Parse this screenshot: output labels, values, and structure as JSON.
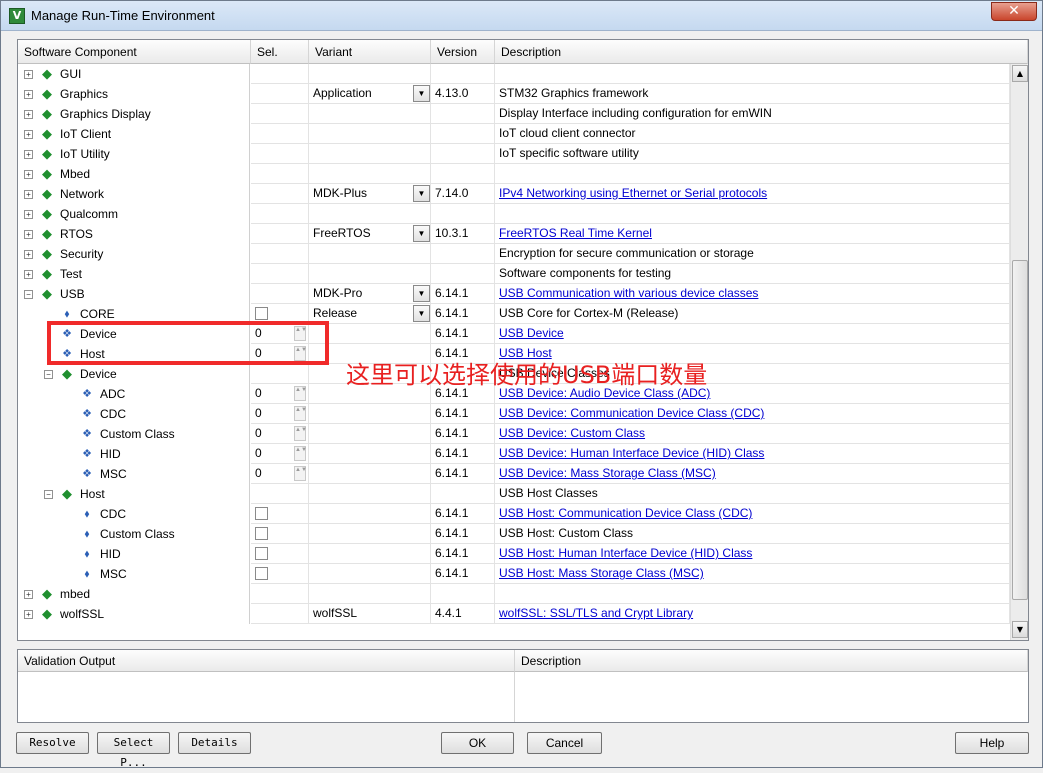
{
  "window": {
    "title": "Manage Run-Time Environment",
    "close_glyph": "✕"
  },
  "columns": {
    "component": "Software Component",
    "sel": "Sel.",
    "variant": "Variant",
    "version": "Version",
    "description": "Description"
  },
  "rows": [
    {
      "label": "GUI",
      "level": 0,
      "icon": "green-diamond-icon",
      "expander": "+",
      "sel": "",
      "variant": "",
      "version": "",
      "description": "",
      "link": false
    },
    {
      "label": "Graphics",
      "level": 0,
      "icon": "green-diamond-icon",
      "expander": "+",
      "sel": "",
      "variant": "Application",
      "variant_dropdown": true,
      "version": "4.13.0",
      "description": "STM32 Graphics framework",
      "link": false
    },
    {
      "label": "Graphics Display",
      "level": 0,
      "icon": "green-diamond-icon",
      "expander": "+",
      "sel": "",
      "variant": "",
      "version": "",
      "description": "Display Interface including configuration for emWIN",
      "link": false
    },
    {
      "label": "IoT Client",
      "level": 0,
      "icon": "green-diamond-icon",
      "expander": "+",
      "sel": "",
      "variant": "",
      "version": "",
      "description": "IoT cloud client connector",
      "link": false
    },
    {
      "label": "IoT Utility",
      "level": 0,
      "icon": "green-diamond-icon",
      "expander": "+",
      "sel": "",
      "variant": "",
      "version": "",
      "description": "IoT specific software utility",
      "link": false
    },
    {
      "label": "Mbed",
      "level": 0,
      "icon": "green-diamond-icon",
      "expander": "+",
      "sel": "",
      "variant": "",
      "version": "",
      "description": "",
      "link": false
    },
    {
      "label": "Network",
      "level": 0,
      "icon": "green-diamond-icon",
      "expander": "+",
      "sel": "",
      "variant": "MDK-Plus",
      "variant_dropdown": true,
      "version": "7.14.0",
      "description": "IPv4 Networking using Ethernet or Serial protocols",
      "link": true
    },
    {
      "label": "Qualcomm",
      "level": 0,
      "icon": "green-diamond-icon",
      "expander": "+",
      "sel": "",
      "variant": "",
      "version": "",
      "description": "",
      "link": false
    },
    {
      "label": "RTOS",
      "level": 0,
      "icon": "green-diamond-icon",
      "expander": "+",
      "sel": "",
      "variant": "FreeRTOS",
      "variant_dropdown": true,
      "version": "10.3.1",
      "description": "FreeRTOS Real Time Kernel",
      "link": true
    },
    {
      "label": "Security",
      "level": 0,
      "icon": "green-diamond-icon",
      "expander": "+",
      "sel": "",
      "variant": "",
      "version": "",
      "description": "Encryption for secure communication or storage",
      "link": false
    },
    {
      "label": "Test",
      "level": 0,
      "icon": "green-diamond-icon",
      "expander": "+",
      "sel": "",
      "variant": "",
      "version": "",
      "description": "Software components for testing",
      "link": false
    },
    {
      "label": "USB",
      "level": 0,
      "icon": "green-diamond-icon",
      "expander": "−",
      "sel": "",
      "variant": "MDK-Pro",
      "variant_dropdown": true,
      "version": "6.14.1",
      "description": "USB Communication with various device classes",
      "link": true
    },
    {
      "label": "CORE",
      "level": 1,
      "icon": "blue-component-icon",
      "expander": "",
      "sel": "checkbox",
      "variant": "Release",
      "variant_dropdown": true,
      "version": "6.14.1",
      "description": "USB Core for Cortex-M (Release)",
      "link": false
    },
    {
      "label": "Device",
      "level": 1,
      "icon": "blue-multi-icon",
      "expander": "",
      "sel": "0",
      "sel_spin": true,
      "variant": "",
      "version": "6.14.1",
      "description": "USB Device",
      "link": true
    },
    {
      "label": "Host",
      "level": 1,
      "icon": "blue-multi-icon",
      "expander": "",
      "sel": "0",
      "sel_spin": true,
      "variant": "",
      "version": "6.14.1",
      "description": "USB Host",
      "link": true
    },
    {
      "label": "Device",
      "level": 1,
      "icon": "green-diamond-icon",
      "expander": "−",
      "sel": "",
      "variant": "",
      "version": "",
      "description": "USB Device Classes",
      "link": false
    },
    {
      "label": "ADC",
      "level": 2,
      "icon": "blue-multi-icon",
      "expander": "",
      "sel": "0",
      "sel_spin": true,
      "variant": "",
      "version": "6.14.1",
      "description": "USB Device: Audio Device Class (ADC)",
      "link": true
    },
    {
      "label": "CDC",
      "level": 2,
      "icon": "blue-multi-icon",
      "expander": "",
      "sel": "0",
      "sel_spin": true,
      "variant": "",
      "version": "6.14.1",
      "description": "USB Device: Communication Device Class (CDC)",
      "link": true
    },
    {
      "label": "Custom Class",
      "level": 2,
      "icon": "blue-multi-icon",
      "expander": "",
      "sel": "0",
      "sel_spin": true,
      "variant": "",
      "version": "6.14.1",
      "description": "USB Device: Custom Class",
      "link": true
    },
    {
      "label": "HID",
      "level": 2,
      "icon": "blue-multi-icon",
      "expander": "",
      "sel": "0",
      "sel_spin": true,
      "variant": "",
      "version": "6.14.1",
      "description": "USB Device: Human Interface Device (HID) Class",
      "link": true
    },
    {
      "label": "MSC",
      "level": 2,
      "icon": "blue-multi-icon",
      "expander": "",
      "sel": "0",
      "sel_spin": true,
      "variant": "",
      "version": "6.14.1",
      "description": "USB Device: Mass Storage Class (MSC)",
      "link": true
    },
    {
      "label": "Host",
      "level": 1,
      "icon": "green-diamond-icon",
      "expander": "−",
      "sel": "",
      "variant": "",
      "version": "",
      "description": "USB Host Classes",
      "link": false
    },
    {
      "label": "CDC",
      "level": 2,
      "icon": "blue-component-icon",
      "expander": "",
      "sel": "checkbox",
      "variant": "",
      "version": "6.14.1",
      "description": "USB Host: Communication Device Class (CDC)",
      "link": true
    },
    {
      "label": "Custom Class",
      "level": 2,
      "icon": "blue-component-icon",
      "expander": "",
      "sel": "checkbox",
      "variant": "",
      "version": "6.14.1",
      "description": "USB Host: Custom Class",
      "link": false
    },
    {
      "label": "HID",
      "level": 2,
      "icon": "blue-component-icon",
      "expander": "",
      "sel": "checkbox",
      "variant": "",
      "version": "6.14.1",
      "description": "USB Host: Human Interface Device (HID) Class",
      "link": true
    },
    {
      "label": "MSC",
      "level": 2,
      "icon": "blue-component-icon",
      "expander": "",
      "sel": "checkbox",
      "variant": "",
      "version": "6.14.1",
      "description": "USB Host: Mass Storage Class (MSC)",
      "link": true
    },
    {
      "label": "mbed",
      "level": 0,
      "icon": "green-diamond-icon",
      "expander": "+",
      "sel": "",
      "variant": "",
      "version": "",
      "description": "",
      "link": false
    },
    {
      "label": "wolfSSL",
      "level": 0,
      "icon": "green-diamond-icon",
      "expander": "+",
      "sel": "",
      "variant": "wolfSSL",
      "version": "4.4.1",
      "description": "wolfSSL: SSL/TLS and Crypt Library",
      "link": true
    }
  ],
  "annotation": {
    "text": "这里可以选择使用的USB端口数量",
    "color": "#f02a2a"
  },
  "validation": {
    "output_header": "Validation Output",
    "description_header": "Description"
  },
  "buttons": {
    "resolve": "Resolve",
    "select_packs": "Select P...",
    "details": "Details",
    "ok": "OK",
    "cancel": "Cancel",
    "help": "Help"
  },
  "colors": {
    "link": "#0000d0",
    "green_icon": "#1f8f2f",
    "blue_icon": "#2b5fb6"
  }
}
